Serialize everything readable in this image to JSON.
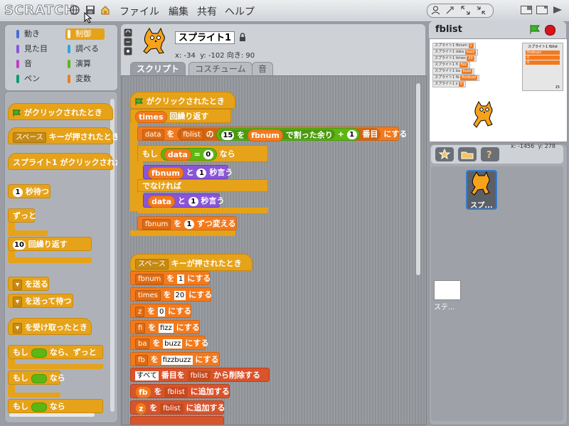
{
  "app": {
    "logo": "SCRATCH"
  },
  "menu": {
    "file": "ファイル",
    "edit": "編集",
    "share": "共有",
    "help": "ヘルプ"
  },
  "categories": [
    {
      "label": "動き",
      "color": "#4a6cd4"
    },
    {
      "label": "制御",
      "color": "#e6a219",
      "selected": true
    },
    {
      "label": "見た目",
      "color": "#8a55d7"
    },
    {
      "label": "調べる",
      "color": "#2ca5e2"
    },
    {
      "label": "音",
      "color": "#bb42c3"
    },
    {
      "label": "演算",
      "color": "#5cb712"
    },
    {
      "label": "ペン",
      "color": "#0e9a6c"
    },
    {
      "label": "変数",
      "color": "#f27a1e"
    }
  ],
  "palette": {
    "b1": "がクリックされたとき",
    "b2_key": "スペース",
    "b2": "キーが押されたとき",
    "b3": "スプライト1 がクリックされたとき",
    "b4_num": "1",
    "b4": "秒待つ",
    "b5": "ずっと",
    "b6_num": "10",
    "b6": "回繰り返す",
    "b7": "を送る",
    "b8": "を送って待つ",
    "b9": "を受け取ったとき",
    "b10": "もし",
    "b10b": "なら、ずっと",
    "b11": "もし",
    "b11b": "なら",
    "b12": "もし",
    "b12b": "なら"
  },
  "sprite": {
    "name": "スプライト1",
    "x_label": "x:",
    "x": "-34",
    "y_label": "y:",
    "y": "-102",
    "dir_label": "向き:",
    "dir": "90"
  },
  "tabs": {
    "scripts": "スクリプト",
    "costumes": "コスチューム",
    "sounds": "音"
  },
  "script": {
    "s1_hat": "がクリックされたとき",
    "s1_rep_var": "times",
    "s1_rep": "回繰り返す",
    "s1_item_var": "data",
    "s1_item_wo": "を",
    "s1_list": "fblist",
    "s1_no": "の",
    "s1_15": "15",
    "s1_wo2": "を",
    "s1_fbnum": "fbnum",
    "s1_mod": "で割った余り",
    "s1_plus": "+",
    "s1_one": "1",
    "s1_th": "番目",
    "s1_set": "にする",
    "s1_if": "もし",
    "s1_data": "data",
    "s1_eq": "=",
    "s1_zero": "0",
    "s1_then": "なら",
    "s1_say1_var": "fbnum",
    "s1_and": "と",
    "s1_sec": "1",
    "s1_say": "秒言う",
    "s1_else": "でなければ",
    "s1_say2_var": "data",
    "s1_change_var": "fbnum",
    "s1_change_wo": "を",
    "s1_change_num": "1",
    "s1_change": "ずつ変える",
    "s2_key": "スペース",
    "s2_hat": "キーが押されたとき",
    "s2_r1_var": "fbnum",
    "s2_r1_val": "1",
    "s2_r2_var": "times",
    "s2_r2_val": "20",
    "s2_r3_var": "z",
    "s2_r3_val": "0",
    "s2_r4_var": "fi",
    "s2_r4_val": "fizz",
    "s2_r5_var": "ba",
    "s2_r5_val": "buzz",
    "s2_r6_var": "fb",
    "s2_r6_val": "fizzbuzz",
    "set_wo": "を",
    "set_ni": "にする",
    "s2_del_all": "すべて",
    "s2_del_th": "番目を",
    "s2_del_list": "fblist",
    "s2_del": "から削除する",
    "s2_add1_var": "fb",
    "s2_add_wo": "を",
    "s2_add_list": "fblist",
    "s2_add": "に追加する",
    "s2_add2_var": "z"
  },
  "stage": {
    "title": "fblist",
    "coords_x": "x: -1456",
    "coords_y": "y: 278",
    "monitors": [
      {
        "label": "スプライト1 fbnum",
        "value": "1"
      },
      {
        "label": "スプライト1 data",
        "value": "buzz"
      },
      {
        "label": "スプライト1 times",
        "value": "20"
      },
      {
        "label": "スプライト1 fi",
        "value": "fizz"
      },
      {
        "label": "スプライト1 ba",
        "value": "buzz"
      },
      {
        "label": "スプライト1 fb",
        "value": "fizzbuzz"
      },
      {
        "label": "スプライト1 z",
        "value": "0"
      }
    ],
    "list_title": "スプライト1 fblist",
    "list_items": [
      "fizzbuzz",
      "0",
      "0"
    ],
    "list_len": "15"
  },
  "sprites": {
    "sprite1_label": "スプ...",
    "stage_label": "ステ..."
  }
}
